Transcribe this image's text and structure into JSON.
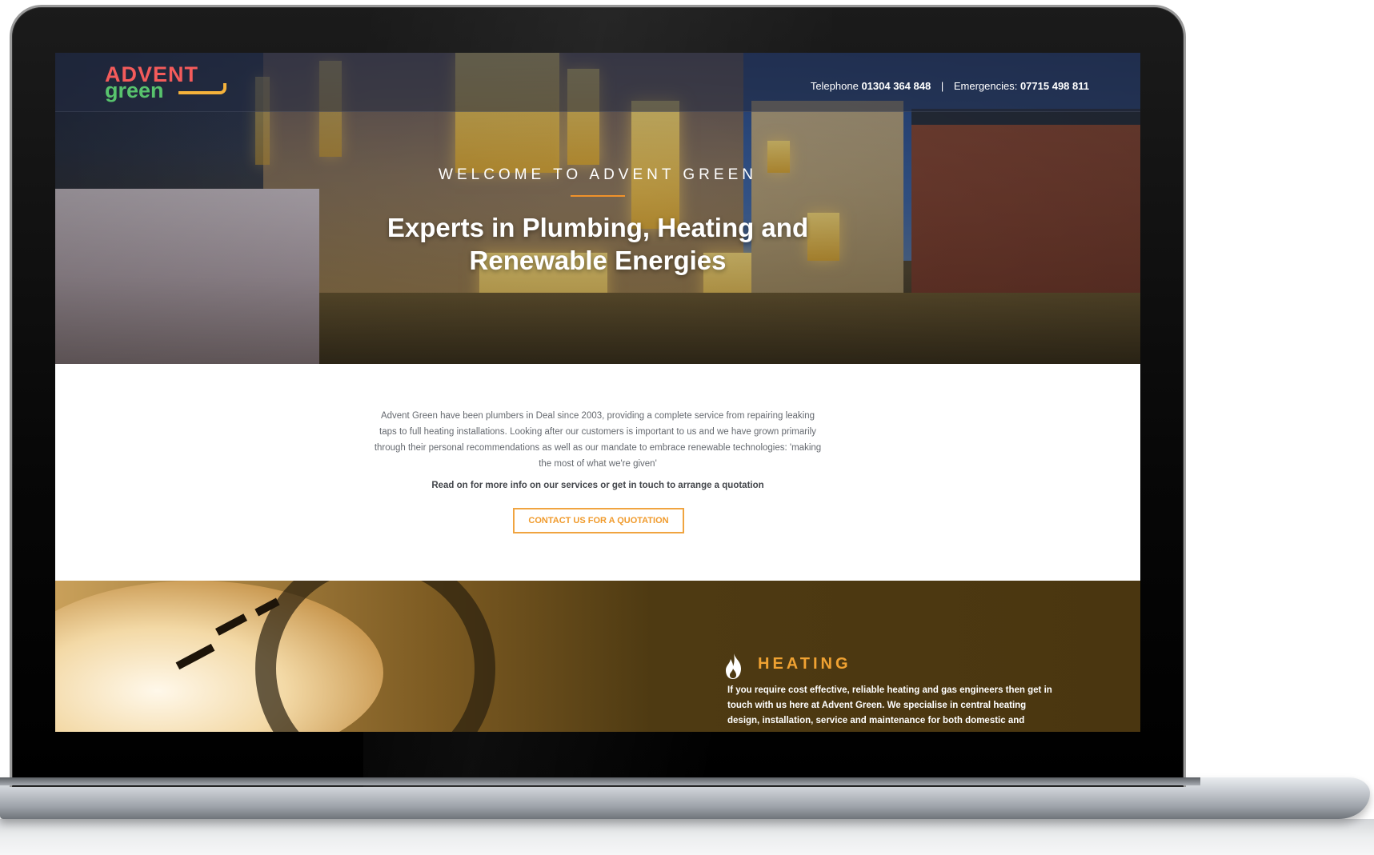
{
  "header": {
    "logo_line1": "ADVENT",
    "logo_line2": "green",
    "telephone_label": "Telephone",
    "telephone_number": "01304 364 848",
    "separator": "|",
    "emergencies_label": "Emergencies:",
    "emergencies_number": "07715 498 811"
  },
  "hero": {
    "welcome": "WELCOME TO ADVENT GREEN",
    "headline_line1": "Experts in Plumbing, Heating and",
    "headline_line2": "Renewable Energies"
  },
  "intro": {
    "paragraph": "Advent Green have been plumbers in Deal since 2003, providing a complete service from repairing leaking taps to full heating installations. Looking after our customers is important to us and we have grown primarily through their personal recommendations as well as our mandate to embrace renewable technologies: 'making the most of what we're given'",
    "cta_text": "Read on for more info on our services or get in touch to arrange a quotation",
    "button_label": "CONTACT US FOR A QUOTATION"
  },
  "heating": {
    "icon": "flame-icon",
    "title": "HEATING",
    "text": "If you require cost effective, reliable heating and gas engineers then get in touch with us here at Advent Green. We specialise in central heating design, installation, service and maintenance for both domestic and"
  },
  "colors": {
    "accent_orange": "#f0922b",
    "logo_red": "#f45b5b",
    "logo_green": "#58c36d"
  }
}
